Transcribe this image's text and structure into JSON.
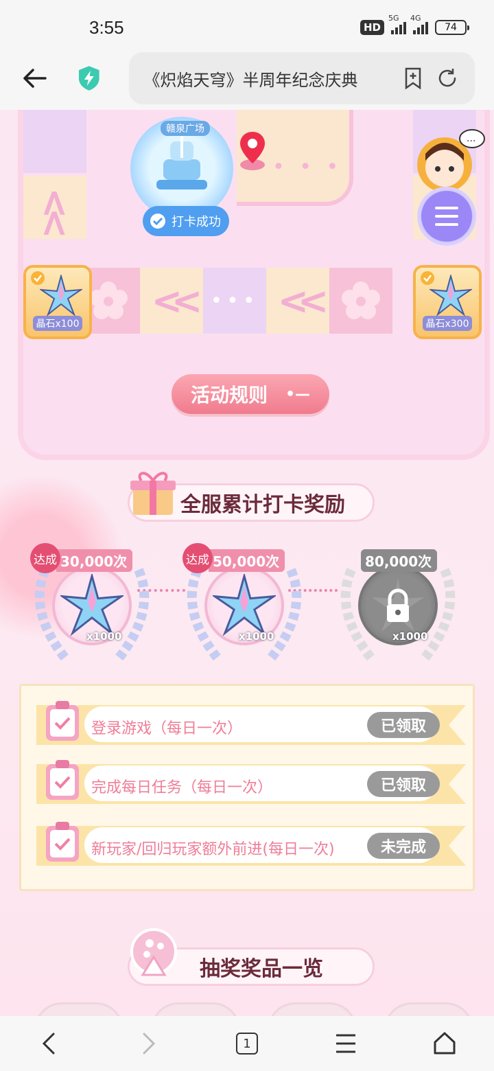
{
  "status_bar": {
    "time": "3:55",
    "hd_label": "HD",
    "net1": "5G",
    "net2": "4G",
    "battery": "74"
  },
  "browser": {
    "page_title": "《炽焰天穹》半周年纪念庆典"
  },
  "board": {
    "fountain_label": "赣泉广场",
    "checkin_badge": "打卡成功",
    "corner_left_reward": "晶石x100",
    "corner_right_reward": "晶石x300"
  },
  "rules_button": "活动规则",
  "cumulative_section_title": "全服累计打卡奖励",
  "milestones": [
    {
      "reach": "达成",
      "count": "30,000次",
      "qty": "x1000",
      "locked": false
    },
    {
      "reach": "达成",
      "count": "50,000次",
      "qty": "x1000",
      "locked": false
    },
    {
      "count": "80,000次",
      "qty": "x1000",
      "locked": true
    }
  ],
  "tasks": [
    {
      "label": "登录游戏（每日一次）",
      "status": "已领取"
    },
    {
      "label": "完成每日任务（每日一次）",
      "status": "已领取"
    },
    {
      "label": "新玩家/回归玩家额外前进(每日一次)",
      "status": "未完成"
    }
  ],
  "prize_section_title": "抽奖奖品一览",
  "nav": {
    "tab_count": "1"
  },
  "colors": {
    "accent_pink": "#f07b8e",
    "status_gray": "#9a9a9a",
    "checkin_blue": "#4f9ef0",
    "menu_purple": "#9b87f5"
  }
}
